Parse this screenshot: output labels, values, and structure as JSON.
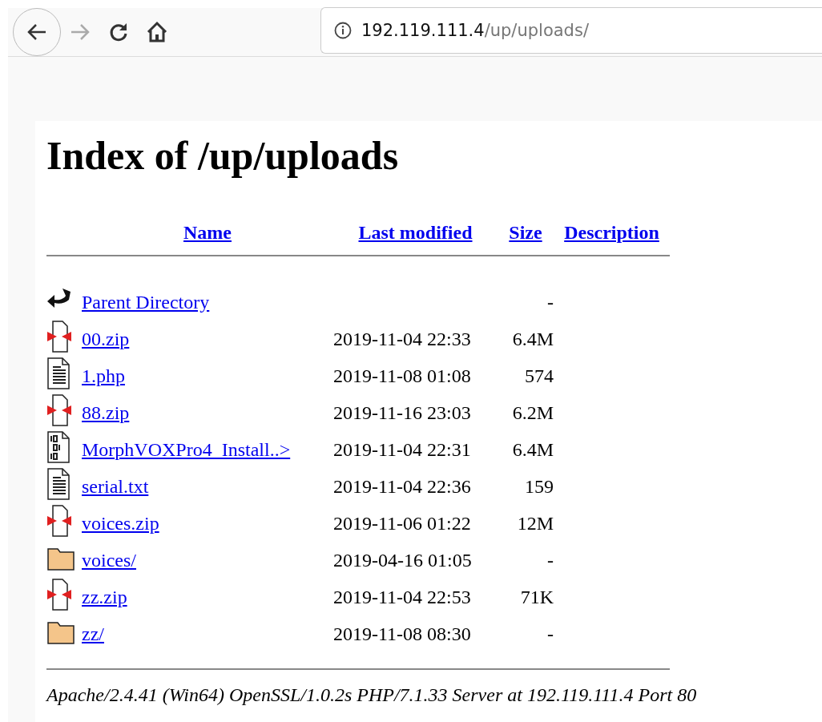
{
  "browser": {
    "url_host": "192.119.111.4",
    "url_path": "/up/uploads/"
  },
  "heading": "Index of /up/uploads",
  "columns": [
    "Name",
    "Last modified",
    "Size",
    "Description"
  ],
  "rows": [
    {
      "kind": "back",
      "name": "Parent Directory",
      "size": "-"
    },
    {
      "kind": "compressed",
      "name": "00.zip",
      "modified": "2019-11-04 22:33",
      "size": "6.4M"
    },
    {
      "kind": "text",
      "name": "1.php",
      "modified": "2019-11-08 01:08",
      "size": "574"
    },
    {
      "kind": "compressed",
      "name": "88.zip",
      "modified": "2019-11-16 23:03",
      "size": "6.2M"
    },
    {
      "kind": "binary",
      "name": "MorphVOXPro4_Install..>",
      "modified": "2019-11-04 22:31",
      "size": "6.4M"
    },
    {
      "kind": "text",
      "name": "serial.txt",
      "modified": "2019-11-04 22:36",
      "size": "159"
    },
    {
      "kind": "compressed",
      "name": "voices.zip",
      "modified": "2019-11-06 01:22",
      "size": "12M"
    },
    {
      "kind": "folder",
      "name": "voices/",
      "modified": "2019-04-16 01:05",
      "size": "-"
    },
    {
      "kind": "compressed",
      "name": "zz.zip",
      "modified": "2019-11-04 22:53",
      "size": "71K"
    },
    {
      "kind": "folder",
      "name": "zz/",
      "modified": "2019-11-08 08:30",
      "size": "-"
    }
  ],
  "footer": "Apache/2.4.41 (Win64) OpenSSL/1.0.2s PHP/7.1.33 Server at 192.119.111.4 Port 80"
}
